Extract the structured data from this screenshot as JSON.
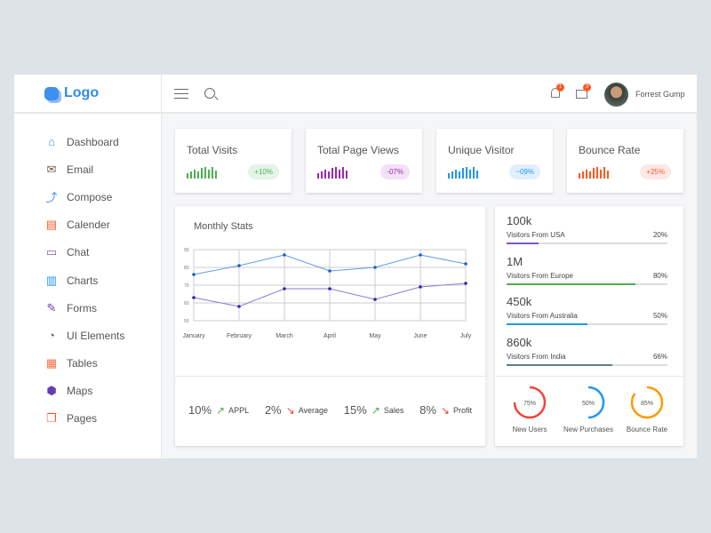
{
  "brand": {
    "logo_text": "Logo"
  },
  "sidebar": {
    "items": [
      {
        "label": "Dashboard",
        "icon": "home-icon",
        "color": "#3d8ff0"
      },
      {
        "label": "Email",
        "icon": "mail-icon",
        "color": "#795548"
      },
      {
        "label": "Compose",
        "icon": "compose-icon",
        "color": "#3d8ff0"
      },
      {
        "label": "Calender",
        "icon": "calendar-icon",
        "color": "#ff5722"
      },
      {
        "label": "Chat",
        "icon": "chat-icon",
        "color": "#7e57c2"
      },
      {
        "label": "Charts",
        "icon": "chart-icon",
        "color": "#2196f3"
      },
      {
        "label": "Forms",
        "icon": "pen-icon",
        "color": "#673ab7"
      },
      {
        "label": "UI Elements",
        "icon": "palette-icon",
        "color": "#795548"
      },
      {
        "label": "Tables",
        "icon": "table-icon",
        "color": "#ff7043"
      },
      {
        "label": "Maps",
        "icon": "map-pin-icon",
        "color": "#673ab7"
      },
      {
        "label": "Pages",
        "icon": "pages-icon",
        "color": "#ff5722"
      }
    ]
  },
  "header": {
    "notifications_count": "1",
    "messages_count": "3",
    "user_name": "Forrest Gump"
  },
  "stats": [
    {
      "title": "Total Visits",
      "change": "+10%",
      "color": "#4caf50",
      "bg": "#e6f4e7"
    },
    {
      "title": "Total Page Views",
      "change": "-07%",
      "color": "#9c27b0",
      "bg": "#f1e2f4"
    },
    {
      "title": "Unique Visitor",
      "change": "~09%",
      "color": "#2196f3",
      "bg": "#e1effd"
    },
    {
      "title": "Bounce Rate",
      "change": "+25%",
      "color": "#ff5722",
      "bg": "#fde8e4"
    }
  ],
  "monthly": {
    "title": "Monthly Stats"
  },
  "chart_data": {
    "type": "line",
    "categories": [
      "January",
      "February",
      "March",
      "April",
      "May",
      "June",
      "July"
    ],
    "ylim": [
      50,
      90
    ],
    "yticks": [
      90,
      80,
      70,
      60,
      50
    ],
    "grid": true,
    "series": [
      {
        "values": [
          76,
          81,
          87,
          78,
          80,
          87,
          82
        ],
        "color": "#5b9ee8"
      },
      {
        "values": [
          63,
          58,
          68,
          68,
          62,
          69,
          71
        ],
        "color": "#8c7ad6"
      }
    ]
  },
  "stocks": [
    {
      "value": "10%",
      "label": "APPL",
      "dir": "up"
    },
    {
      "value": "2%",
      "label": "Average",
      "dir": "down"
    },
    {
      "value": "15%",
      "label": "Sales",
      "dir": "up"
    },
    {
      "value": "8%",
      "label": "Profit",
      "dir": "down"
    }
  ],
  "countries": [
    {
      "value": "100k",
      "label": "Visitors From USA",
      "percent": "20%",
      "fill": 20,
      "color": "#7e57c2"
    },
    {
      "value": "1M",
      "label": "Visitors From Europe",
      "percent": "80%",
      "fill": 80,
      "color": "#4caf50"
    },
    {
      "value": "450k",
      "label": "Visitors From Australia",
      "percent": "50%",
      "fill": 50,
      "color": "#2196f3"
    },
    {
      "value": "860k",
      "label": "Visitors From India",
      "percent": "66%",
      "fill": 66,
      "color": "#607d8b"
    }
  ],
  "donuts": [
    {
      "value": "75%",
      "label": "New Users",
      "fill": 75,
      "color": "#f44336"
    },
    {
      "value": "50%",
      "label": "New Purchases",
      "fill": 50,
      "color": "#2196f3"
    },
    {
      "value": "85%",
      "label": "Bounce Rate",
      "fill": 85,
      "color": "#ff9800"
    }
  ]
}
